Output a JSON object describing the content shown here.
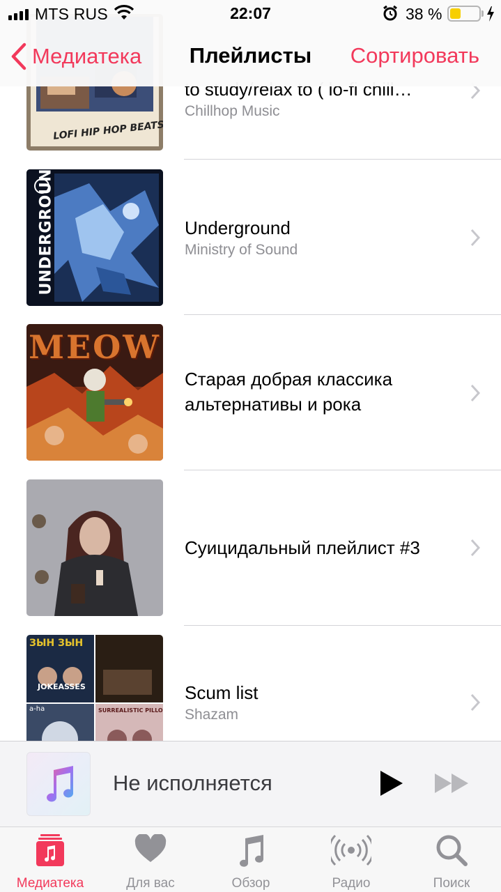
{
  "status_bar": {
    "carrier": "MTS RUS",
    "time": "22:07",
    "battery_percent_text": "38 %",
    "battery_level": 0.38,
    "icons": [
      "signal-bars-icon",
      "wifi-icon",
      "alarm-icon",
      "battery-icon",
      "charging-bolt-icon"
    ]
  },
  "nav": {
    "back_label": "Медиатека",
    "title": "Плейлисты",
    "sort_label": "Сортировать"
  },
  "playlists": [
    {
      "title": "to study/relax to ( lo-fi chill…",
      "subtitle": "Chillhop Music",
      "art_text": "LOFI HIP HOP BEATS"
    },
    {
      "title": "Underground",
      "subtitle": "Ministry of Sound",
      "art_text": "UNDERGROUND"
    },
    {
      "title": "Старая добрая классика альтернативы и рока",
      "subtitle": "",
      "art_text": "MEOW"
    },
    {
      "title": "Суицидальный плейлист #3",
      "subtitle": "",
      "art_text": ""
    },
    {
      "title": "Scum list",
      "subtitle": "Shazam",
      "art_text": [
        "ЗЫН ЗЫН",
        "JOKEASSES",
        "a-ha",
        "SURREALISTIC PILLOW"
      ]
    }
  ],
  "mini_player": {
    "title": "Не исполняется",
    "icons": [
      "music-note-icon",
      "play-icon",
      "fast-forward-icon"
    ]
  },
  "tabs": [
    {
      "label": "Медиатека",
      "icon": "library-icon",
      "active": true
    },
    {
      "label": "Для вас",
      "icon": "heart-icon",
      "active": false
    },
    {
      "label": "Обзор",
      "icon": "music-note-icon",
      "active": false
    },
    {
      "label": "Радио",
      "icon": "radio-icon",
      "active": false
    },
    {
      "label": "Поиск",
      "icon": "search-icon",
      "active": false
    }
  ],
  "colors": {
    "accent": "#f2395b",
    "secondary_text": "#8e8e93",
    "inactive_tab": "#929297",
    "battery_fill": "#f7cf00"
  }
}
